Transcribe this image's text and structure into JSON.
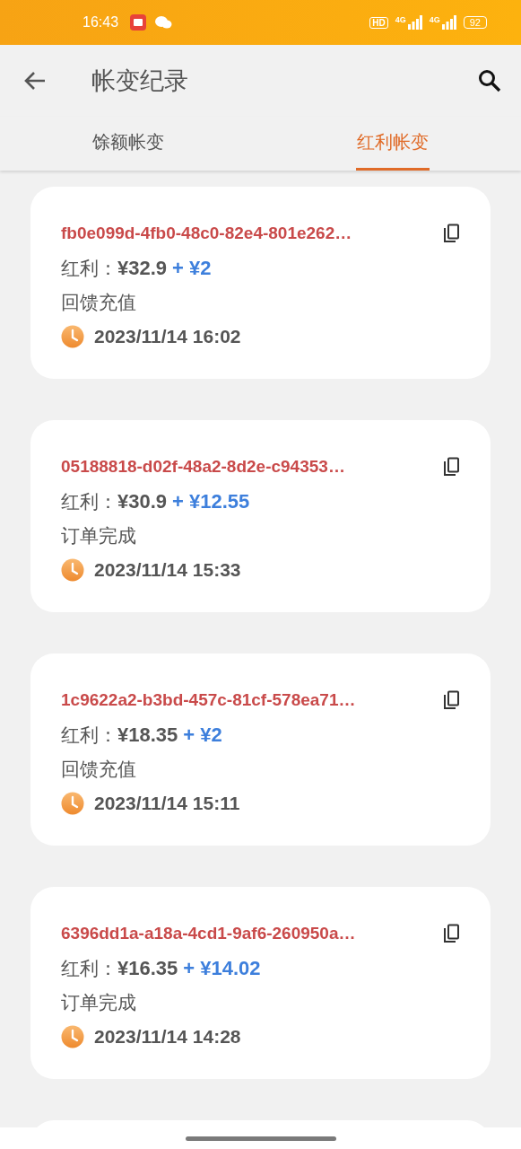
{
  "status_bar": {
    "time": "16:43",
    "indicators": [
      "HD",
      "4G",
      "4G"
    ],
    "battery": "92"
  },
  "header": {
    "title": "帐变纪录"
  },
  "tabs": [
    {
      "label": "馀额帐变",
      "selected": false
    },
    {
      "label": "红利帐变",
      "selected": true
    }
  ],
  "records": [
    {
      "id": "fb0e099d-4fb0-48c0-82e4-801e262…",
      "label": "红利：",
      "amount": "¥32.9",
      "bonus": "+ ¥2",
      "type": "回馈充值",
      "time": "2023/11/14 16:02"
    },
    {
      "id": "05188818-d02f-48a2-8d2e-c94353…",
      "label": "红利：",
      "amount": "¥30.9",
      "bonus": "+ ¥12.55",
      "type": "订单完成",
      "time": "2023/11/14 15:33"
    },
    {
      "id": "1c9622a2-b3bd-457c-81cf-578ea71…",
      "label": "红利：",
      "amount": "¥18.35",
      "bonus": "+ ¥2",
      "type": "回馈充值",
      "time": "2023/11/14 15:11"
    },
    {
      "id": "6396dd1a-a18a-4cd1-9af6-260950a…",
      "label": "红利：",
      "amount": "¥16.35",
      "bonus": "+ ¥14.02",
      "type": "订单完成",
      "time": "2023/11/14 14:28"
    }
  ]
}
